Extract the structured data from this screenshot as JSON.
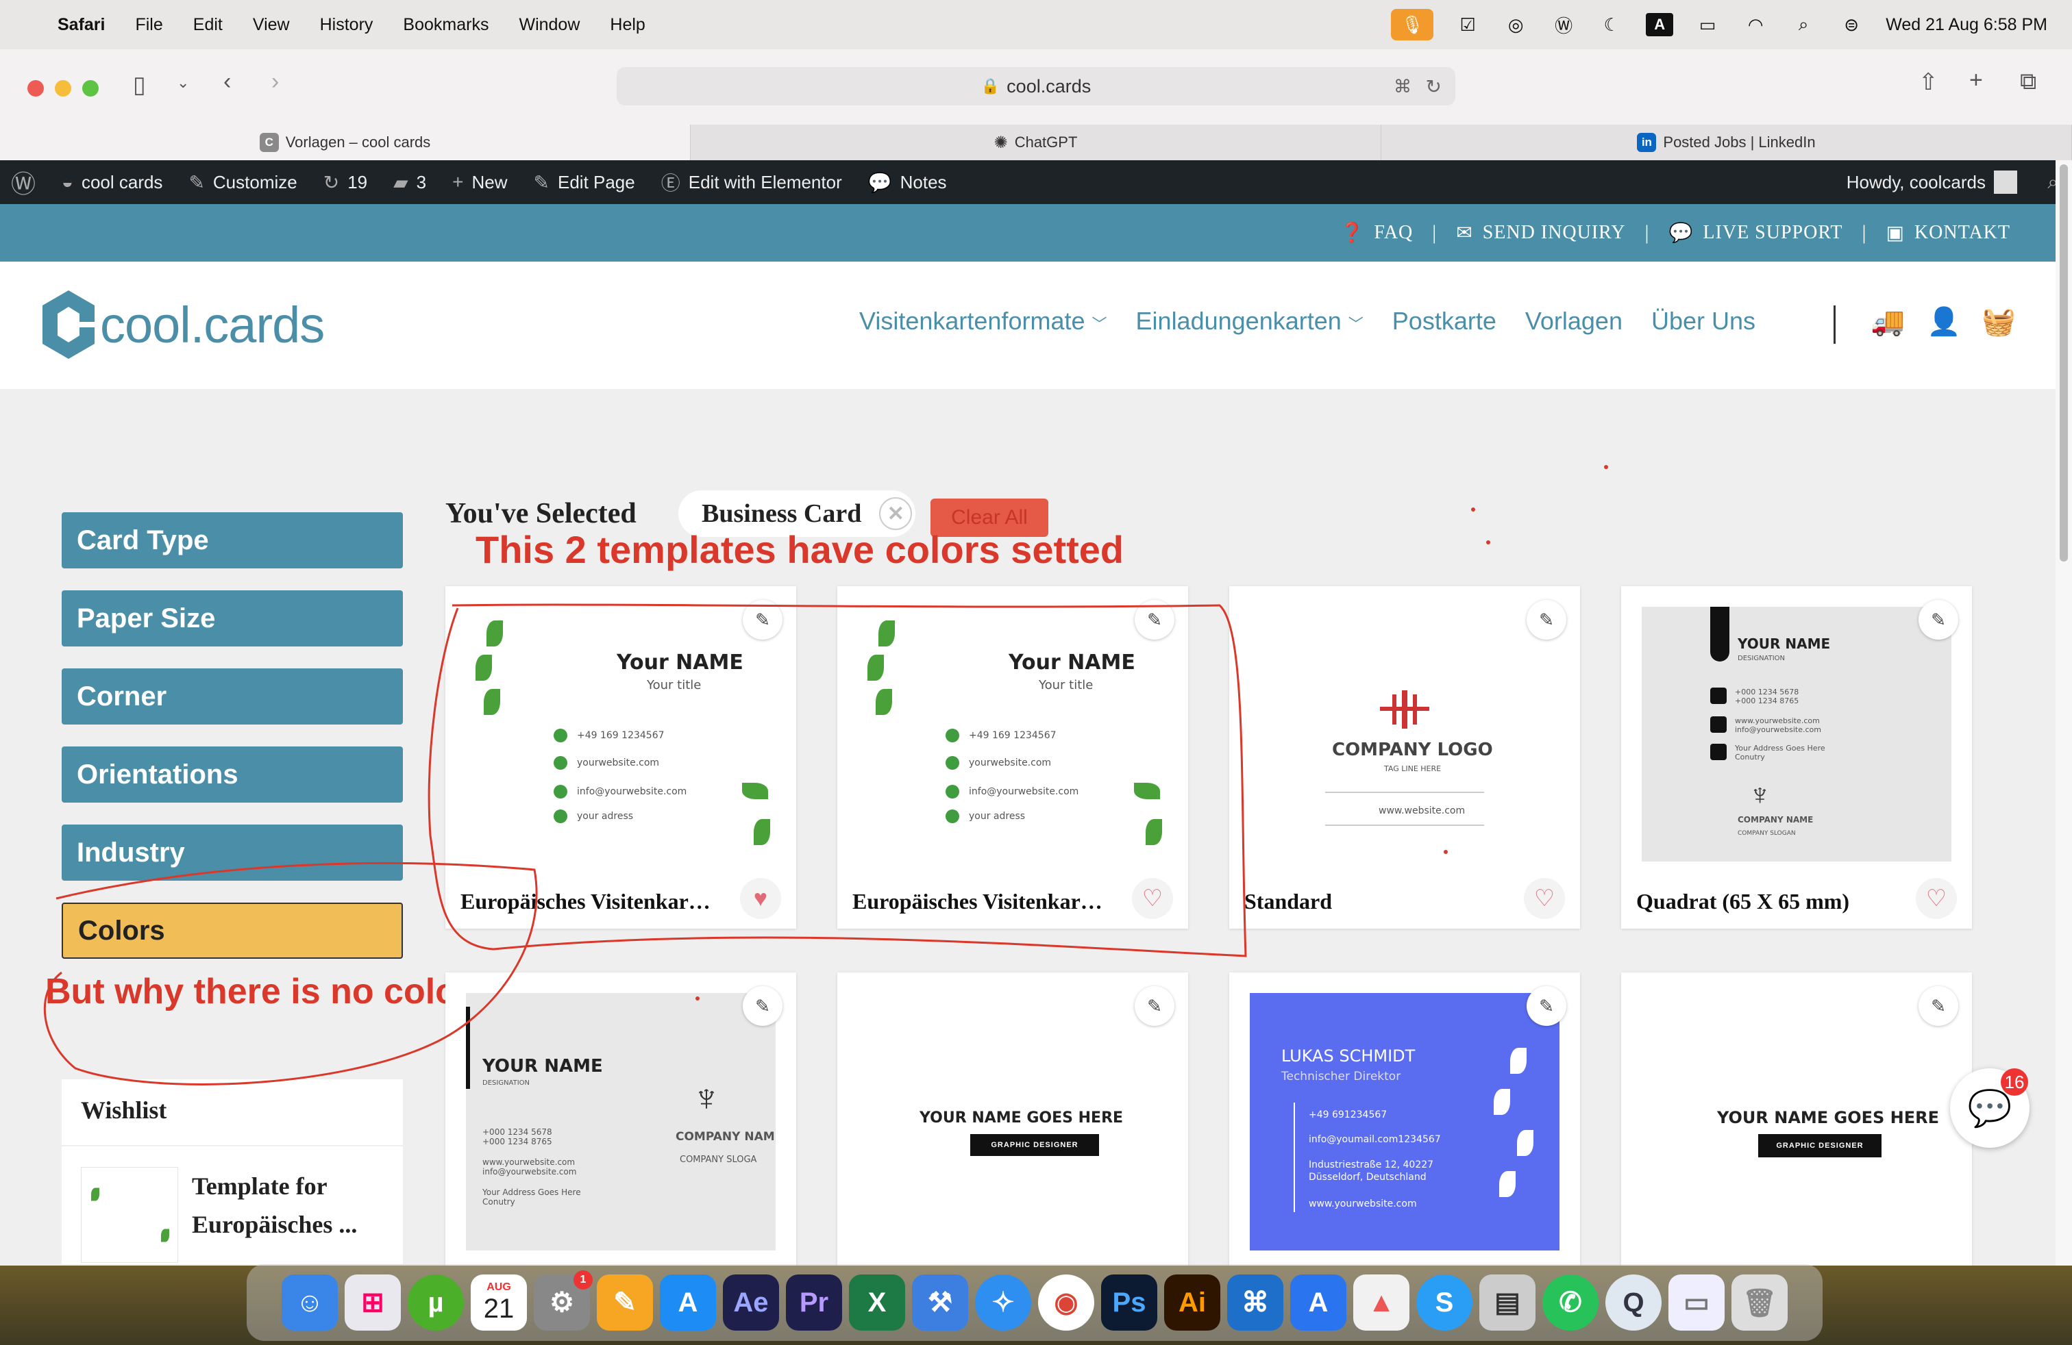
{
  "menubar": {
    "app": "Safari",
    "items": [
      "File",
      "Edit",
      "View",
      "History",
      "Bookmarks",
      "Window",
      "Help"
    ],
    "clock": "Wed 21 Aug  6:58 PM"
  },
  "browser": {
    "url": "cool.cards",
    "tabs": [
      "Vorlagen – cool cards",
      "ChatGPT",
      "Posted Jobs | LinkedIn"
    ]
  },
  "wpbar": {
    "site": "cool cards",
    "customize": "Customize",
    "updates": "19",
    "comments": "3",
    "new": "New",
    "edit_page": "Edit Page",
    "elementor": "Edit with Elementor",
    "notes": "Notes",
    "howdy": "Howdy, coolcards"
  },
  "topbar": {
    "faq": "FAQ",
    "inquiry": "SEND INQUIRY",
    "support": "LIVE SUPPORT",
    "kontakt": "KONTAKT"
  },
  "header": {
    "logo": "cool.cards",
    "nav": [
      "Visitenkartenformate",
      "Einladungenkarten",
      "Postkarte",
      "Vorlagen",
      "Über Uns"
    ]
  },
  "filters": [
    "Card Type",
    "Paper Size",
    "Corner",
    "Orientations",
    "Industry",
    "Colors"
  ],
  "selected": {
    "label": "You've Selected",
    "chip": "Business Card",
    "clear": "Clear All"
  },
  "annotations": {
    "top": "This 2 templates have colors setted",
    "side": "But why there is no color?"
  },
  "wishlist": {
    "title": "Wishlist",
    "item": "Template for Europäisches ..."
  },
  "cards": [
    {
      "title": "Europäisches Visitenkar…",
      "name": "Your NAME",
      "subtitle": "Your title",
      "lines": [
        "+49 169 1234567",
        "yourwebsite.com",
        "info@yourwebsite.com",
        "your adress"
      ]
    },
    {
      "title": "Europäisches Visitenkar…",
      "name": "Your NAME",
      "subtitle": "Your title",
      "lines": [
        "+49 169 1234567",
        "yourwebsite.com",
        "info@yourwebsite.com",
        "your adress"
      ]
    },
    {
      "title": "Standard",
      "logo": "COMPANY LOGO",
      "tagline": "TAG LINE HERE",
      "website": "www.website.com"
    },
    {
      "title": "Quadrat (65 X 65 mm)",
      "name": "YOUR NAME",
      "designation": "DESIGNATION",
      "lines": [
        "+000 1234 5678\n+000 1234 8765",
        "www.yourwebsite.com\ninfo@yourwebsite.com",
        "Your Address Goes Here\nConutry"
      ],
      "company": "COMPANY NAME",
      "slogan": "COMPANY SLOGAN"
    },
    {
      "name": "YOUR NAME",
      "designation": "DESIGNATION",
      "lines": [
        "+000 1234 5678\n+000 1234 8765",
        "www.yourwebsite.com\ninfo@yourwebsite.com",
        "Your Address Goes Here\nConutry"
      ],
      "company": "COMPANY NAM",
      "slogan": "COMPANY SLOGA"
    },
    {
      "name": "YOUR NAME GOES HERE",
      "role": "GRAPHIC DESIGNER"
    },
    {
      "name": "LUKAS SCHMIDT",
      "role": "Technischer Direktor",
      "lines": [
        "+49 691234567",
        "info@youmail.com1234567",
        "Industriestraße 12, 40227\nDüsseldorf, Deutschland",
        "www.yourwebsite.com"
      ]
    },
    {
      "name": "YOUR NAME GOES HERE",
      "role": "GRAPHIC DESIGNER"
    }
  ],
  "chat_badge": "16",
  "dock": {
    "calendar_month": "AUG",
    "calendar_day": "21",
    "settings_badge": "1"
  },
  "colors": {
    "brand": "#4a8ea8",
    "active_filter": "#f1bd57",
    "annotation": "#d9382a"
  }
}
